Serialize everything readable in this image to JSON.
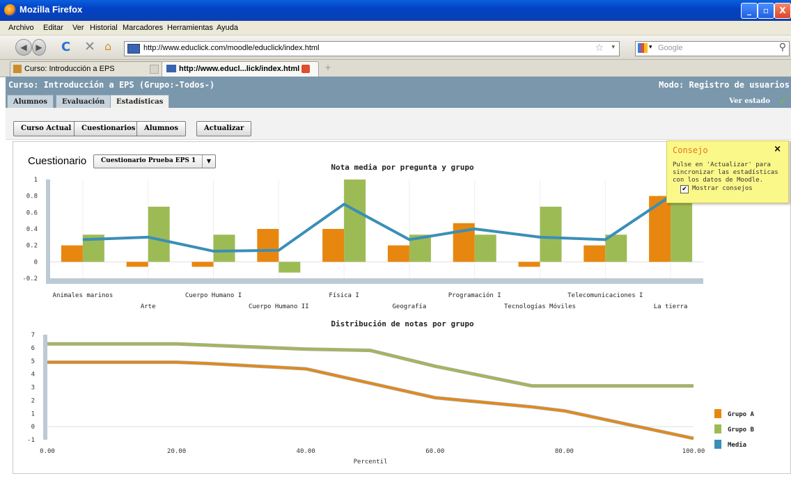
{
  "window": {
    "title": "Mozilla Firefox",
    "buttons": {
      "min": "_",
      "max": "▫",
      "close": "X"
    }
  },
  "menu": [
    "Archivo",
    "Editar",
    "Ver",
    "Historial",
    "Marcadores",
    "Herramientas",
    "Ayuda"
  ],
  "nav": {
    "url": "http://www.educlick.com/moodle/educlick/index.html",
    "search_placeholder": "Google"
  },
  "tabs": [
    {
      "label": "Curso: Introducción a EPS",
      "active": false
    },
    {
      "label": "http://www.educl...lick/index.html",
      "active": true
    }
  ],
  "app": {
    "course": "Curso: Introducción a EPS  (Grupo:-Todos-)",
    "mode": "Modo: Registro de usuarios",
    "tabs": [
      "Alumnos",
      "Evaluación",
      "Estadísticas"
    ],
    "active_tab": "Estadísticas",
    "ver_estado": "Ver estado",
    "toolbar": [
      "Curso Actual",
      "Cuestionarios",
      "Alumnos",
      "Actualizar"
    ],
    "cuestionario_label": "Cuestionario",
    "cuestionario_value": "Cuestionario Prueba EPS 1"
  },
  "tip": {
    "title": "Consejo",
    "close": "×",
    "body": "Pulse en 'Actualizar' para sincronizar las estadísticas con los datos de Moodle.",
    "checkbox_label": "Mostrar consejos",
    "checked": true
  },
  "colors": {
    "grupo_a": "#e8870f",
    "grupo_b": "#9dbb55",
    "media": "#3a8fb7",
    "header": "#7a97ac"
  },
  "chart_data": [
    {
      "type": "bar",
      "title": "Nota media por pregunta y grupo",
      "categories": [
        "Animales marinos",
        "Arte",
        "Cuerpo Humano I",
        "Cuerpo Humano II",
        "Física I",
        "Geografía",
        "Programación I",
        "Tecnologías Móviles",
        "Telecomunicaciones I",
        "La tierra"
      ],
      "series": [
        {
          "name": "Grupo A",
          "values": [
            0.2,
            -0.06,
            -0.06,
            0.4,
            0.4,
            0.2,
            0.47,
            -0.06,
            0.2,
            0.8
          ],
          "kind": "bar"
        },
        {
          "name": "Grupo B",
          "values": [
            0.33,
            0.67,
            0.33,
            -0.13,
            1.0,
            0.33,
            0.33,
            0.67,
            0.33,
            0.8
          ],
          "kind": "bar"
        },
        {
          "name": "Media",
          "values": [
            0.27,
            0.3,
            0.13,
            0.14,
            0.7,
            0.27,
            0.4,
            0.3,
            0.27,
            0.8
          ],
          "kind": "line"
        }
      ],
      "yticks": [
        "1",
        "0.8",
        "0.6",
        "0.4",
        "0.2",
        "0",
        "-0.2"
      ],
      "ylim": [
        -0.2,
        1
      ]
    },
    {
      "type": "line",
      "title": "Distribución de notas por grupo",
      "xlabel": "Percentil",
      "x": [
        0,
        20,
        25,
        40,
        50,
        60,
        75,
        80,
        100
      ],
      "series": [
        {
          "name": "Grupo A",
          "values": [
            4.9,
            4.9,
            4.8,
            4.4,
            3.3,
            2.2,
            1.5,
            1.2,
            -0.9
          ]
        },
        {
          "name": "Grupo B",
          "values": [
            6.3,
            6.3,
            6.2,
            5.9,
            5.8,
            4.6,
            3.1,
            3.1,
            3.1
          ]
        }
      ],
      "xticks": [
        "0.00",
        "20.00",
        "40.00",
        "60.00",
        "80.00",
        "100.00"
      ],
      "yticks": [
        "7",
        "6",
        "5",
        "4",
        "3",
        "2",
        "1",
        "0",
        "-1"
      ],
      "xlim": [
        0,
        100
      ],
      "ylim": [
        -1,
        7
      ],
      "legend": [
        "Grupo A",
        "Grupo B",
        "Media"
      ],
      "legend_position": "right"
    }
  ]
}
